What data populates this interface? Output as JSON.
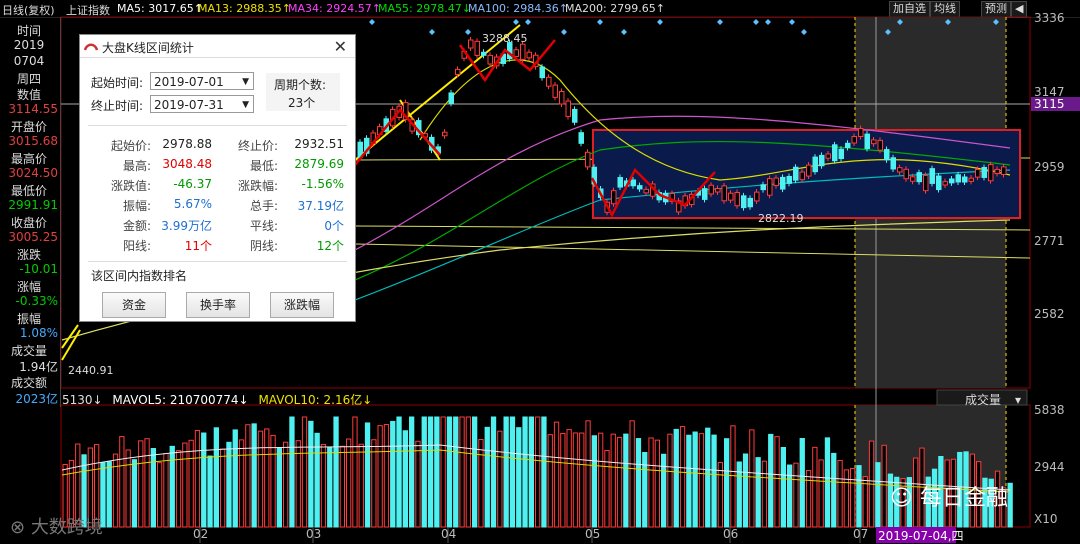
{
  "topbar": {
    "period": "日线(复权)",
    "index": "上证指数",
    "ma5": "MA5: 3017.65↑",
    "ma13": "MA13: 2988.35↑",
    "ma34": "MA34: 2924.57↑",
    "ma55": "MA55: 2978.47↓",
    "ma100": "MA100: 2984.36↑",
    "ma200": "MA200: 2799.65↑",
    "btn_add": "加自选",
    "btn_avg": "均线",
    "btn_alert": "预测",
    "btn_back": "◀"
  },
  "left_panel": {
    "time_label": "时间",
    "year": "2019",
    "date": "0704",
    "weekday": "周四",
    "value_label": "数值",
    "value": "3114.55",
    "open_label": "开盘价",
    "open": "3015.68",
    "high_label": "最高价",
    "high": "3024.50",
    "low_label": "最低价",
    "low": "2991.91",
    "close_label": "收盘价",
    "close": "3005.25",
    "change_label": "涨跌",
    "change": "-10.01",
    "pct_label": "涨幅",
    "pct": "-0.33%",
    "amp_label": "振幅",
    "amp": "1.08%",
    "vol_label": "成交量",
    "vol": "1.94亿",
    "amt_label": "成交额",
    "amt": "2023亿"
  },
  "right_axis": {
    "p1": "3336",
    "p2": "3147",
    "p3": "3115",
    "p4": "2959",
    "p5": "2771",
    "p6": "2582",
    "v1": "5838",
    "v2": "2944",
    "v3": "X10"
  },
  "annotations": {
    "high": "3288.45",
    "low": "2440.91",
    "mid_low": "2822.19"
  },
  "dialog": {
    "title": "大盘K线区间统计",
    "start_label": "起始时间:",
    "start_value": "2019-07-01",
    "end_label": "终止时间:",
    "end_value": "2019-07-31",
    "period_label": "周期个数:",
    "period_value": "23个",
    "stats": [
      {
        "l": "起始价:",
        "v": "2978.88",
        "c": "#222",
        "l2": "终止价:",
        "v2": "2932.51",
        "c2": "#222"
      },
      {
        "l": "最高:",
        "v": "3048.48",
        "c": "#e00000",
        "l2": "最低:",
        "v2": "2879.69",
        "c2": "#009900"
      },
      {
        "l": "涨跌值:",
        "v": "-46.37",
        "c": "#009900",
        "l2": "涨跌幅:",
        "v2": "-1.56%",
        "c2": "#009900"
      },
      {
        "l": "振幅:",
        "v": "5.67%",
        "c": "#1e6fd0",
        "l2": "总手:",
        "v2": "37.19亿",
        "c2": "#1e6fd0"
      },
      {
        "l": "金额:",
        "v": "3.99万亿",
        "c": "#1e6fd0",
        "l2": "平线:",
        "v2": "0个",
        "c2": "#1e6fd0"
      },
      {
        "l": "阳线:",
        "v": "11个",
        "c": "#e00000",
        "l2": "阴线:",
        "v2": "12个",
        "c2": "#009900"
      }
    ],
    "rank_label": "该区间内指数排名",
    "btn_fund": "资金",
    "btn_turnover": "换手率",
    "btn_change": "涨跌幅"
  },
  "volume": {
    "header_val": "5130↓",
    "mavol5": "MAVOL5: 210700774↓",
    "mavol10": "MAVOL10: 2.16亿↓",
    "selector": "成交量"
  },
  "x_axis": {
    "m2": "02",
    "m3": "03",
    "m4": "04",
    "m5": "05",
    "m6": "06",
    "m7": "07",
    "cursor_date": "2019-07-04,四"
  },
  "watermark": {
    "left": "大数跨境",
    "right": "每日金融"
  }
}
